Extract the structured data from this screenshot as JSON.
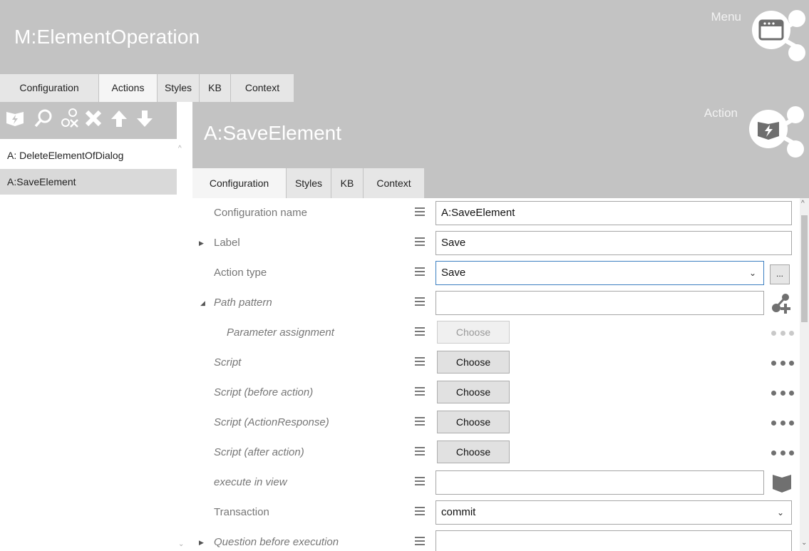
{
  "header": {
    "title": "M:ElementOperation",
    "menu_label": "Menu"
  },
  "top_tabs": [
    {
      "label": "Configuration",
      "active": false
    },
    {
      "label": "Actions",
      "active": true
    },
    {
      "label": "Styles",
      "active": false
    },
    {
      "label": "KB",
      "active": false
    },
    {
      "label": "Context",
      "active": false
    }
  ],
  "left_panel": {
    "toolbar_icons": [
      "add-action-icon",
      "search-icon",
      "unlink-icon",
      "delete-icon",
      "move-up-icon",
      "move-down-icon"
    ],
    "items": [
      {
        "label": "A: DeleteElementOfDialog",
        "selected": false
      },
      {
        "label": "A:SaveElement",
        "selected": true
      }
    ]
  },
  "action": {
    "corner_label": "Action",
    "title": "A:SaveElement",
    "tabs": [
      {
        "label": "Configuration",
        "active": true
      },
      {
        "label": "Styles",
        "active": false
      },
      {
        "label": "KB",
        "active": false
      },
      {
        "label": "Context",
        "active": false
      }
    ]
  },
  "properties": [
    {
      "label": "Configuration name",
      "value": "A:SaveElement",
      "kind": "text"
    },
    {
      "label": "Label",
      "value": "Save",
      "kind": "text",
      "expander": "▶"
    },
    {
      "label": "Action type",
      "value": "Save",
      "kind": "dropdown",
      "ellipsis": "..."
    },
    {
      "label": "Path pattern",
      "value": "",
      "kind": "text",
      "expander": "◢",
      "italic": true
    },
    {
      "label": "Parameter assignment",
      "button": "Choose",
      "kind": "button-disabled",
      "italic": true
    },
    {
      "label": "Script",
      "button": "Choose",
      "kind": "button",
      "italic": true
    },
    {
      "label": "Script (before action)",
      "button": "Choose",
      "kind": "button",
      "italic": true
    },
    {
      "label": "Script (ActionResponse)",
      "button": "Choose",
      "kind": "button",
      "italic": true
    },
    {
      "label": "Script (after action)",
      "button": "Choose",
      "kind": "button",
      "italic": true
    },
    {
      "label": "execute in view",
      "value": "",
      "kind": "text",
      "italic": true
    },
    {
      "label": "Transaction",
      "value": "commit",
      "kind": "dropdown"
    },
    {
      "label": "Question before execution",
      "value": "",
      "kind": "text",
      "expander": "▶",
      "italic": true
    }
  ],
  "colors": {
    "header_bg": "#c3c3c3",
    "focus_border": "#3c7fc1"
  }
}
